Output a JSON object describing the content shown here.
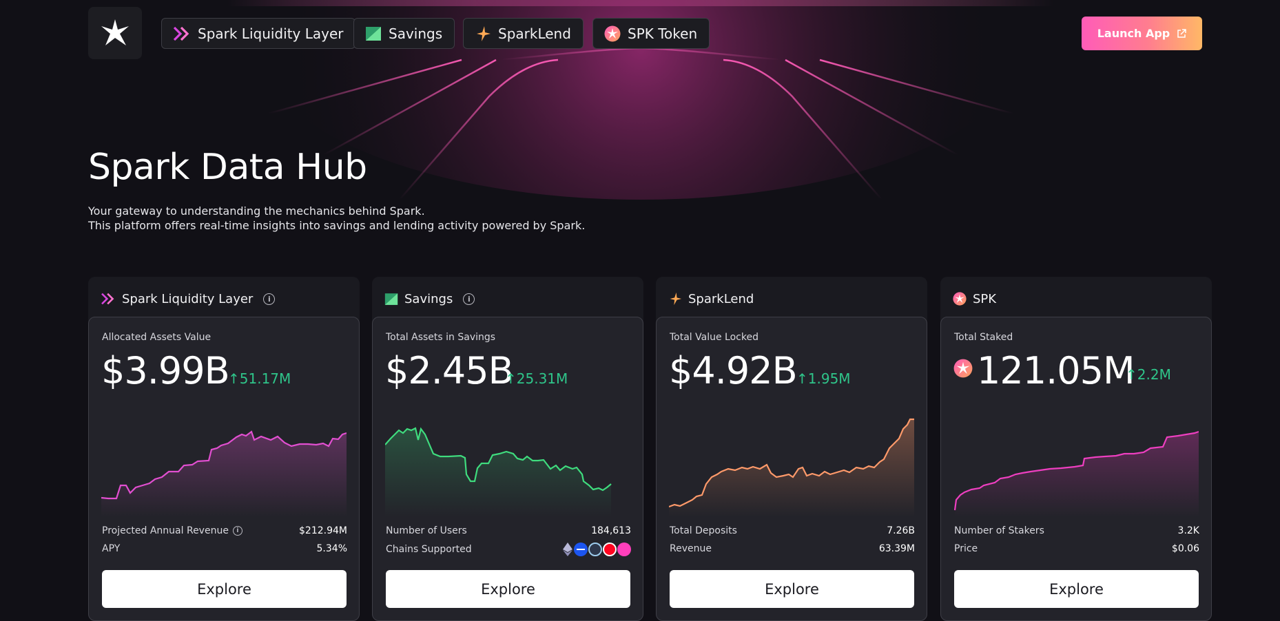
{
  "nav": {
    "items": [
      {
        "label": "Spark Liquidity Layer",
        "icon": "double-chevron-icon"
      },
      {
        "label": "Savings",
        "icon": "savings-icon"
      },
      {
        "label": "SparkLend",
        "icon": "sparkle-icon"
      },
      {
        "label": "SPK Token",
        "icon": "spk-token-icon"
      }
    ],
    "launch_label": "Launch App"
  },
  "hero": {
    "title": "Spark Data Hub",
    "line1": "Your gateway to understanding the mechanics behind Spark.",
    "line2": "This platform offers real-time insights into savings and lending activity powered by Spark."
  },
  "colors": {
    "accent_pink": "#ff5cb8",
    "accent_orange": "#ffb866",
    "positive": "#2fc58a",
    "sll_line": "#e24fd1",
    "savings_line": "#3fdc7e",
    "sparklend_line": "#ff9a6a",
    "spk_line": "#ee3fc0"
  },
  "cards": [
    {
      "title": "Spark Liquidity Layer",
      "metric_label": "Allocated Assets Value",
      "metric_value": "$3.99B",
      "delta": "↑51.17M",
      "row1_label": "Projected Annual Revenue",
      "row1_value": "$212.94M",
      "row2_label": "APY",
      "row2_value": "5.34%",
      "explore": "Explore"
    },
    {
      "title": "Savings",
      "metric_label": "Total Assets in Savings",
      "metric_value": "$2.45B",
      "delta": "↑25.31M",
      "row1_label": "Number of Users",
      "row1_value": "184,613",
      "row2_label": "Chains Supported",
      "chains": [
        "ethereum-icon",
        "base-icon",
        "arbitrum-icon",
        "optimism-icon",
        "unichain-icon"
      ],
      "explore": "Explore"
    },
    {
      "title": "SparkLend",
      "metric_label": "Total Value Locked",
      "metric_value": "$4.92B",
      "delta": "↑1.95M",
      "row1_label": "Total Deposits",
      "row1_value": "7.26B",
      "row2_label": "Revenue",
      "row2_value": "63.39M",
      "explore": "Explore"
    },
    {
      "title": "SPK",
      "metric_label": "Total Staked",
      "metric_value": "121.05M",
      "delta": "↑2.2M",
      "row1_label": "Number of Stakers",
      "row1_value": "3.2K",
      "row2_label": "Price",
      "row2_value": "$0.06",
      "explore": "Explore"
    }
  ]
}
